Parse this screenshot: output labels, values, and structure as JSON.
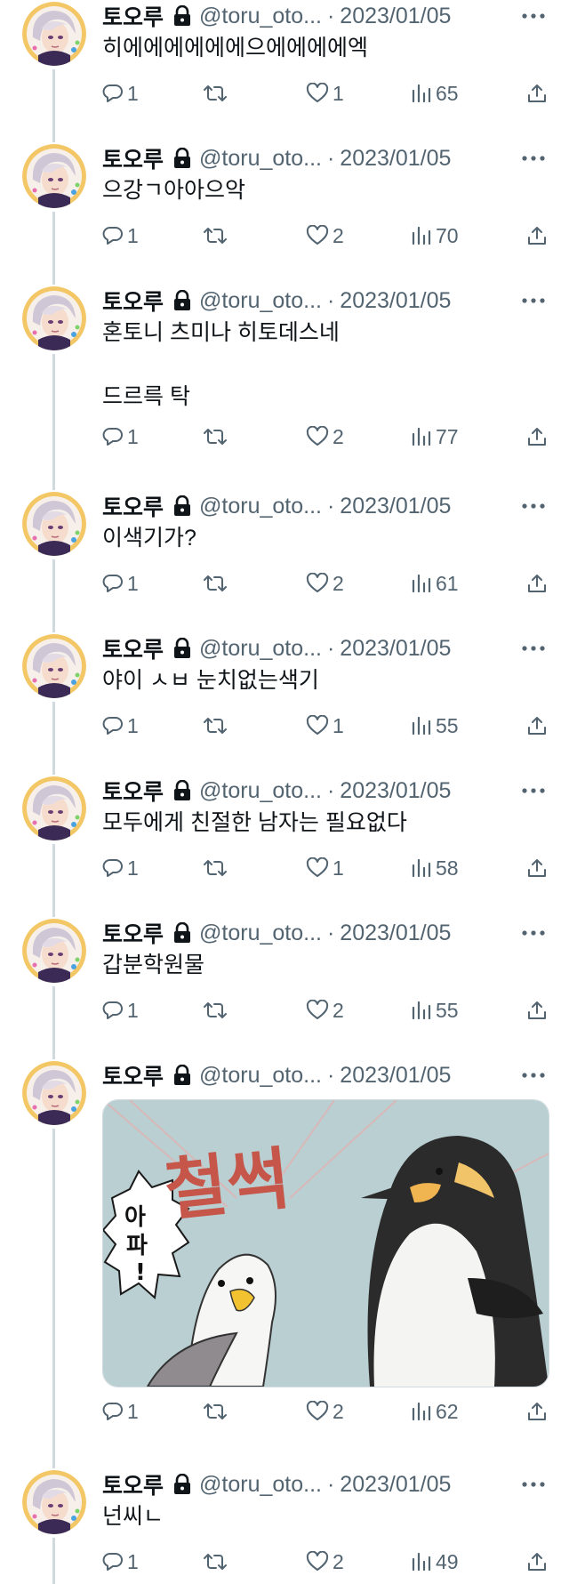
{
  "tweets": [
    {
      "name": "토오루",
      "handle": "@toru_oto...",
      "date": "2023/01/05",
      "text": "히에에에에에에으에에에에엑",
      "replies": "1",
      "likes": "1",
      "views": "65"
    },
    {
      "name": "토오루",
      "handle": "@toru_oto...",
      "date": "2023/01/05",
      "text": "으강ㄱ아아으악",
      "replies": "1",
      "likes": "2",
      "views": "70"
    },
    {
      "name": "토오루",
      "handle": "@toru_oto...",
      "date": "2023/01/05",
      "text": "혼토니 츠미나 히토데스네\n\n드르륵 탁",
      "replies": "1",
      "likes": "2",
      "views": "77"
    },
    {
      "name": "토오루",
      "handle": "@toru_oto...",
      "date": "2023/01/05",
      "text": "이색기가?",
      "replies": "1",
      "likes": "2",
      "views": "61"
    },
    {
      "name": "토오루",
      "handle": "@toru_oto...",
      "date": "2023/01/05",
      "text": "야이 ㅅㅂ 눈치없는색기",
      "replies": "1",
      "likes": "1",
      "views": "55"
    },
    {
      "name": "토오루",
      "handle": "@toru_oto...",
      "date": "2023/01/05",
      "text": "모두에게 친절한 남자는 필요없다",
      "replies": "1",
      "likes": "1",
      "views": "58"
    },
    {
      "name": "토오루",
      "handle": "@toru_oto...",
      "date": "2023/01/05",
      "text": "갑분학원물",
      "replies": "1",
      "likes": "2",
      "views": "55"
    },
    {
      "name": "토오루",
      "handle": "@toru_oto...",
      "date": "2023/01/05",
      "text": "",
      "replies": "1",
      "likes": "2",
      "views": "62",
      "media": {
        "sfx_text": "철썩",
        "bubble_text_1": "아",
        "bubble_text_2": "파",
        "bubble_text_3": "!"
      }
    },
    {
      "name": "토오루",
      "handle": "@toru_oto...",
      "date": "2023/01/05",
      "text": "넌씨ㄴ",
      "replies": "1",
      "likes": "2",
      "views": "49"
    }
  ],
  "separator": "·",
  "colors": {
    "text": "#0f1419",
    "secondary": "#536471",
    "thread_line": "#cfd9de",
    "background": "#ffffff"
  },
  "icons": {
    "reply": "reply-icon",
    "retweet": "retweet-icon",
    "like": "heart-icon",
    "views": "views-icon",
    "share": "share-icon",
    "more": "more-icon",
    "lock": "lock-icon"
  }
}
